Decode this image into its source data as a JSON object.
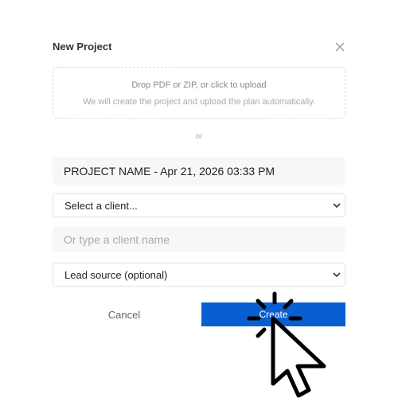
{
  "dialog": {
    "title": "New Project",
    "close_icon": "close-icon"
  },
  "dropzone": {
    "main_text": "Drop PDF or ZIP, or click to upload",
    "sub_text": "We will create the project and upload the plan automatically."
  },
  "separator_text": "or",
  "form": {
    "project_name_value": "PROJECT NAME - Apr 21, 2026 03:33 PM",
    "client_select_value": "Select a client...",
    "client_name_placeholder": "Or type a client name",
    "lead_source_value": "Lead source (optional)"
  },
  "actions": {
    "cancel_label": "Cancel",
    "create_label": "Create"
  },
  "colors": {
    "accent": "#0a5fd0",
    "field_background": "#f7f7f7",
    "border": "#e2e2e2"
  },
  "icons": {
    "close": "close-icon",
    "chevron": "chevron-down-icon",
    "cursor": "click-cursor-icon"
  }
}
